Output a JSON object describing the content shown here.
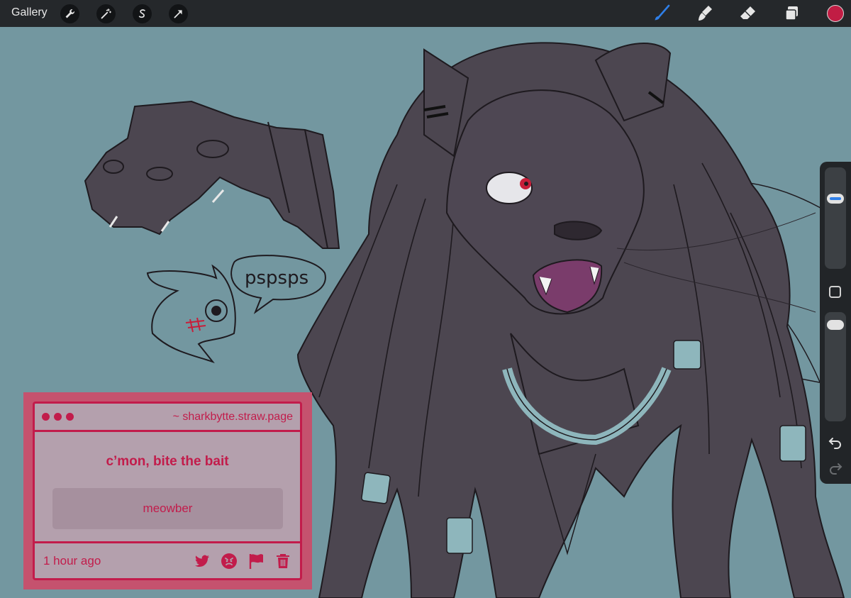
{
  "toolbar": {
    "gallery_label": "Gallery",
    "left_tools": [
      "wrench-icon",
      "magic-wand-icon",
      "selection-icon",
      "transform-arrow-icon"
    ],
    "right_tools": [
      "brush-icon",
      "smudge-icon",
      "eraser-icon",
      "layers-icon"
    ],
    "active_tool": "brush-icon",
    "active_color": "#c11d44",
    "active_tool_color": "#2f7fe8"
  },
  "sidebar": {
    "brush_size_level": 0.27,
    "opacity_level": 0.05,
    "icons": [
      "modify-square-icon",
      "undo-icon",
      "redo-icon"
    ]
  },
  "canvas": {
    "speech_bubble_text": "pspsps",
    "colors": {
      "background": "#7397a0",
      "fur": "#4c4650",
      "lineart": "#1e1a1f",
      "mouth": "#7a3c6b",
      "eye_iris": "#c71e3a",
      "collar": "#8eb6bc"
    }
  },
  "card": {
    "url": "~ sharkbytte.straw.page",
    "title": "c’mon, bite the bait",
    "answer": "meowber",
    "time": "1 hour ago",
    "actions": [
      "twitter-icon",
      "angry-face-icon",
      "flag-icon",
      "trash-icon"
    ],
    "accent_color": "#c21c4b"
  }
}
